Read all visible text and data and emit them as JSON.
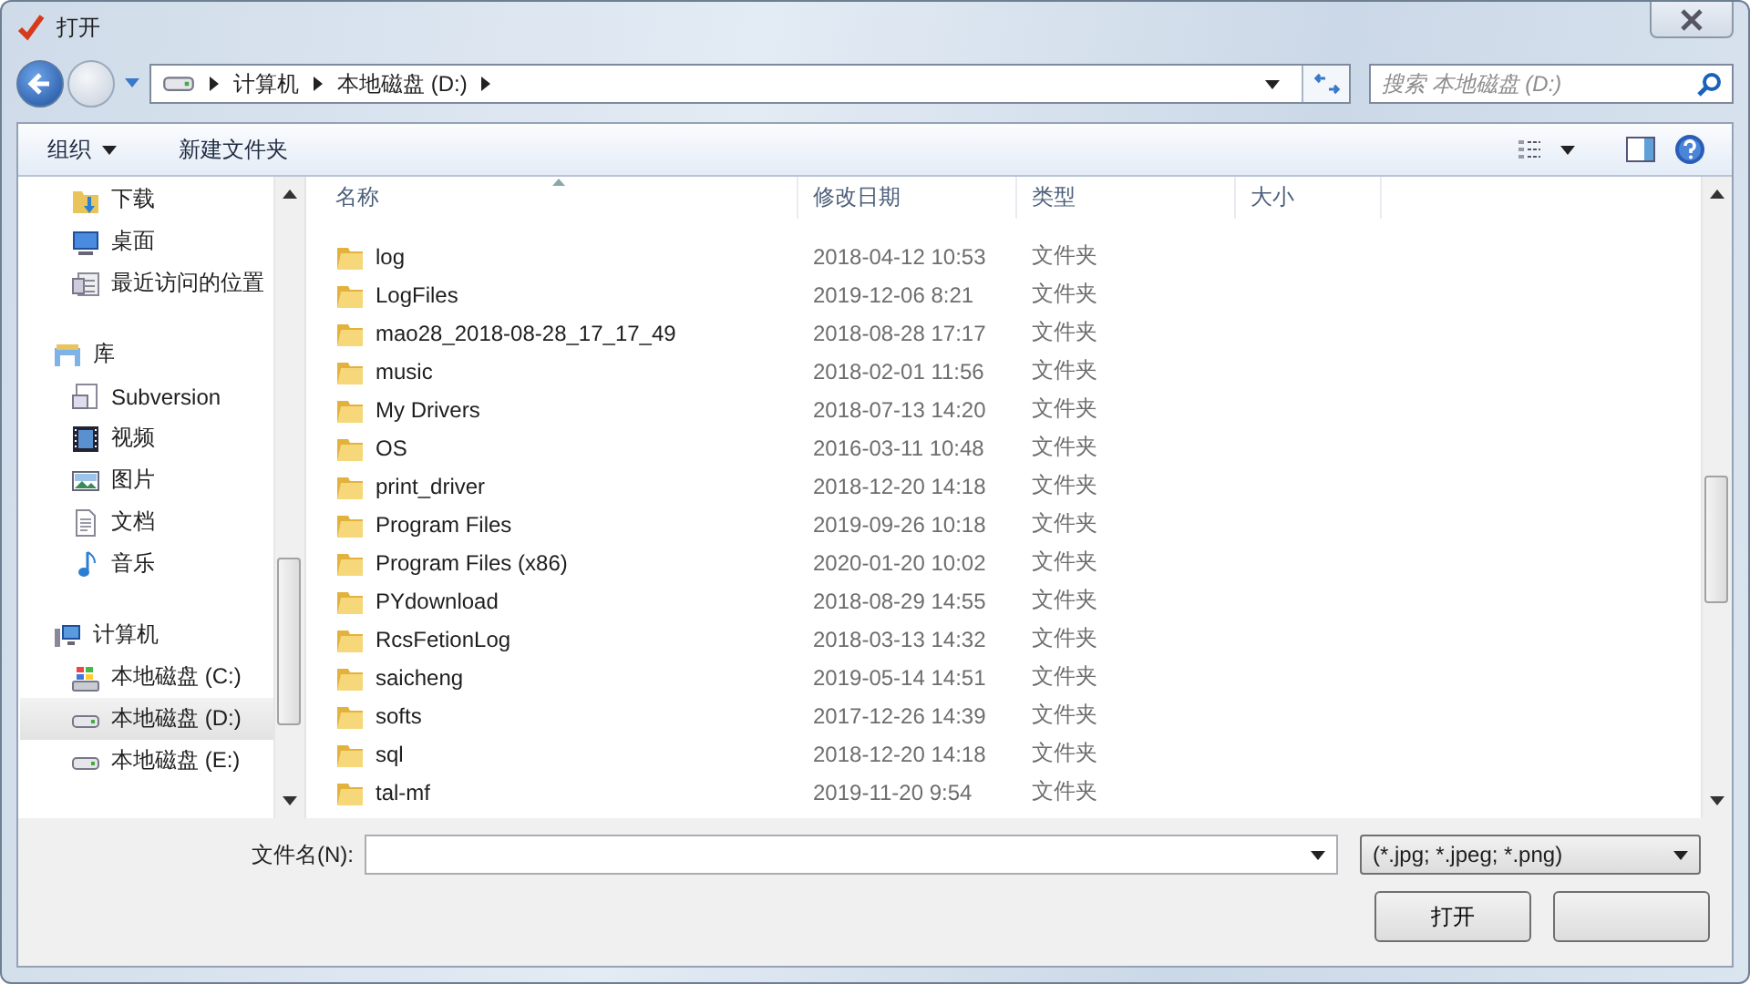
{
  "window": {
    "title": "打开"
  },
  "nav": {
    "breadcrumbs": [
      "计算机",
      "本地磁盘 (D:)"
    ],
    "search_placeholder": "搜索 本地磁盘 (D:)"
  },
  "toolbar": {
    "organize": "组织",
    "new_folder": "新建文件夹"
  },
  "sidebar": {
    "items": [
      {
        "label": "下载",
        "kind": "download",
        "selected": false
      },
      {
        "label": "桌面",
        "kind": "desktop",
        "selected": false
      },
      {
        "label": "最近访问的位置",
        "kind": "recent",
        "selected": false
      },
      {
        "label": "库",
        "kind": "library",
        "selected": false,
        "children": [
          {
            "label": "Subversion",
            "kind": "doclib",
            "selected": false
          },
          {
            "label": "视频",
            "kind": "video",
            "selected": false
          },
          {
            "label": "图片",
            "kind": "picture",
            "selected": false
          },
          {
            "label": "文档",
            "kind": "document",
            "selected": false
          },
          {
            "label": "音乐",
            "kind": "music",
            "selected": false
          }
        ]
      },
      {
        "label": "计算机",
        "kind": "computer",
        "selected": false,
        "children": [
          {
            "label": "本地磁盘 (C:)",
            "kind": "sysdrive",
            "selected": false
          },
          {
            "label": "本地磁盘 (D:)",
            "kind": "drive",
            "selected": true
          },
          {
            "label": "本地磁盘 (E:)",
            "kind": "drive",
            "selected": false
          }
        ]
      }
    ]
  },
  "table": {
    "columns": [
      {
        "label": "名称",
        "sorted": true
      },
      {
        "label": "修改日期",
        "sorted": false
      },
      {
        "label": "类型",
        "sorted": false
      },
      {
        "label": "大小",
        "sorted": false
      }
    ],
    "rows": [
      {
        "name": "log",
        "date": "2018-04-12 10:53",
        "type": "文件夹"
      },
      {
        "name": "LogFiles",
        "date": "2019-12-06 8:21",
        "type": "文件夹"
      },
      {
        "name": "mao28_2018-08-28_17_17_49",
        "date": "2018-08-28 17:17",
        "type": "文件夹"
      },
      {
        "name": "music",
        "date": "2018-02-01 11:56",
        "type": "文件夹"
      },
      {
        "name": "My Drivers",
        "date": "2018-07-13 14:20",
        "type": "文件夹"
      },
      {
        "name": "OS",
        "date": "2016-03-11 10:48",
        "type": "文件夹"
      },
      {
        "name": "print_driver",
        "date": "2018-12-20 14:18",
        "type": "文件夹"
      },
      {
        "name": "Program Files",
        "date": "2019-09-26 10:18",
        "type": "文件夹"
      },
      {
        "name": "Program Files (x86)",
        "date": "2020-01-20 10:02",
        "type": "文件夹"
      },
      {
        "name": "PYdownload",
        "date": "2018-08-29 14:55",
        "type": "文件夹"
      },
      {
        "name": "RcsFetionLog",
        "date": "2018-03-13 14:32",
        "type": "文件夹"
      },
      {
        "name": "saicheng",
        "date": "2019-05-14 14:51",
        "type": "文件夹"
      },
      {
        "name": "softs",
        "date": "2017-12-26 14:39",
        "type": "文件夹"
      },
      {
        "name": "sql",
        "date": "2018-12-20 14:18",
        "type": "文件夹"
      },
      {
        "name": "tal-mf",
        "date": "2019-11-20 9:54",
        "type": "文件夹"
      }
    ]
  },
  "footer": {
    "filename_label": "文件名(N):",
    "filter": "(*.jpg; *.jpeg; *.png)",
    "open_button": "打开"
  }
}
